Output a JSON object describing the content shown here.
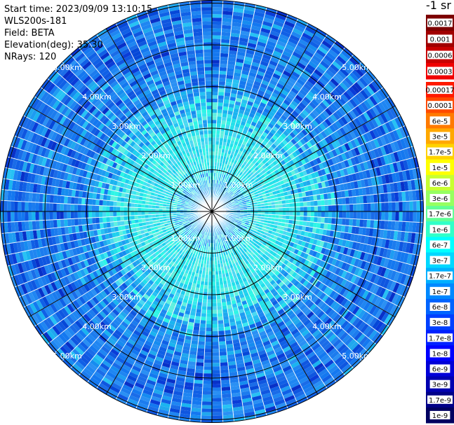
{
  "info": {
    "start_time_label": "Start time:",
    "start_time_value": "2023/09/09 13:10:15",
    "station": "WLS200s-181",
    "field_label": "Field:",
    "field_value": "BETA",
    "elevation_label": "Elevation(deg):",
    "elevation_value": "35.30",
    "nrays_label": "NRays:",
    "nrays_value": "120"
  },
  "units": "-1 sr",
  "colorbar": {
    "labels": [
      "0.0017",
      "0.001",
      "0.0006",
      "0.0003",
      "0.00017",
      "0.0001",
      "6e-5",
      "3e-5",
      "1.7e-5",
      "1e-5",
      "6e-6",
      "3e-6",
      "1.7e-6",
      "1e-6",
      "6e-7",
      "3e-7",
      "1.7e-7",
      "1e-7",
      "6e-8",
      "3e-8",
      "1.7e-8",
      "1e-8",
      "6e-9",
      "3e-9",
      "1.7e-9",
      "1e-9"
    ],
    "colors": [
      "#7d0000",
      "#a00000",
      "#c80000",
      "#f00000",
      "#ff1a00",
      "#ff4a00",
      "#ff7a00",
      "#ffa800",
      "#ffd200",
      "#ffff00",
      "#c8ff30",
      "#96ff60",
      "#60ff96",
      "#30ffc8",
      "#00ffff",
      "#00d8ff",
      "#00b0ff",
      "#0088ff",
      "#0064ff",
      "#0040ff",
      "#0020ff",
      "#0000ff",
      "#0000d8",
      "#0000b0",
      "#000088",
      "#000060"
    ],
    "top_section_end": 5
  },
  "range_rings": {
    "labels": [
      "1.00km",
      "2.00km",
      "3.00km",
      "4.00km",
      "5.00km"
    ]
  },
  "colors": {
    "background": "#ffffff",
    "ring_line": "#000000"
  }
}
